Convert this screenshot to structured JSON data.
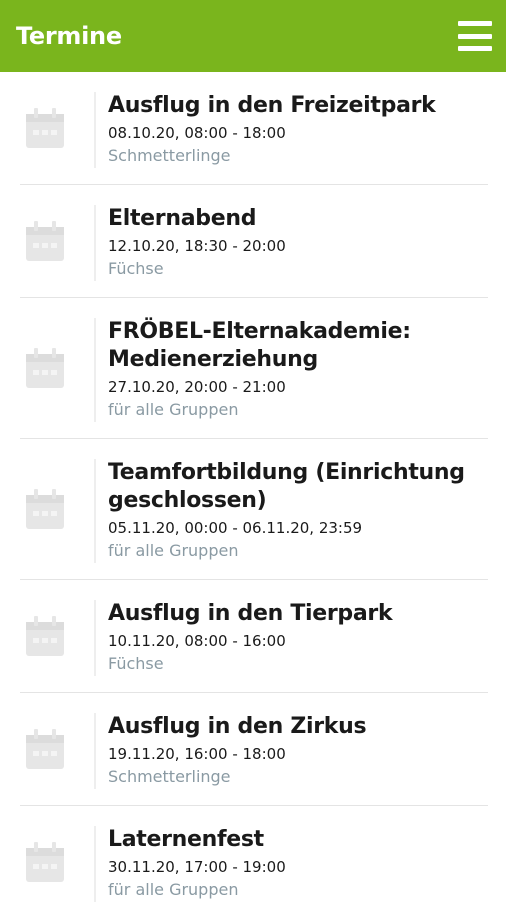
{
  "header": {
    "title": "Termine",
    "menu_icon": "hamburger-menu-icon"
  },
  "colors": {
    "accent": "#7ab51d",
    "group_text": "#8a9aa3",
    "icon": "#e6e6e6"
  },
  "events": [
    {
      "title": "Ausflug in den Freizeitpark",
      "time": "08.10.20, 08:00 - 18:00",
      "group": "Schmetterlinge"
    },
    {
      "title": "Elternabend",
      "time": "12.10.20, 18:30 - 20:00",
      "group": "Füchse"
    },
    {
      "title": "FRÖBEL-Elternakademie: Medienerziehung",
      "time": "27.10.20, 20:00 - 21:00",
      "group": "für alle Gruppen"
    },
    {
      "title": "Teamfortbildung (Einrichtung geschlossen)",
      "time": "05.11.20, 00:00 - 06.11.20, 23:59",
      "group": "für alle Gruppen"
    },
    {
      "title": "Ausflug in den Tierpark",
      "time": "10.11.20, 08:00 - 16:00",
      "group": "Füchse"
    },
    {
      "title": "Ausflug in den Zirkus",
      "time": "19.11.20, 16:00 - 18:00",
      "group": "Schmetterlinge"
    },
    {
      "title": "Laternenfest",
      "time": "30.11.20, 17:00 - 19:00",
      "group": "für alle Gruppen"
    }
  ]
}
